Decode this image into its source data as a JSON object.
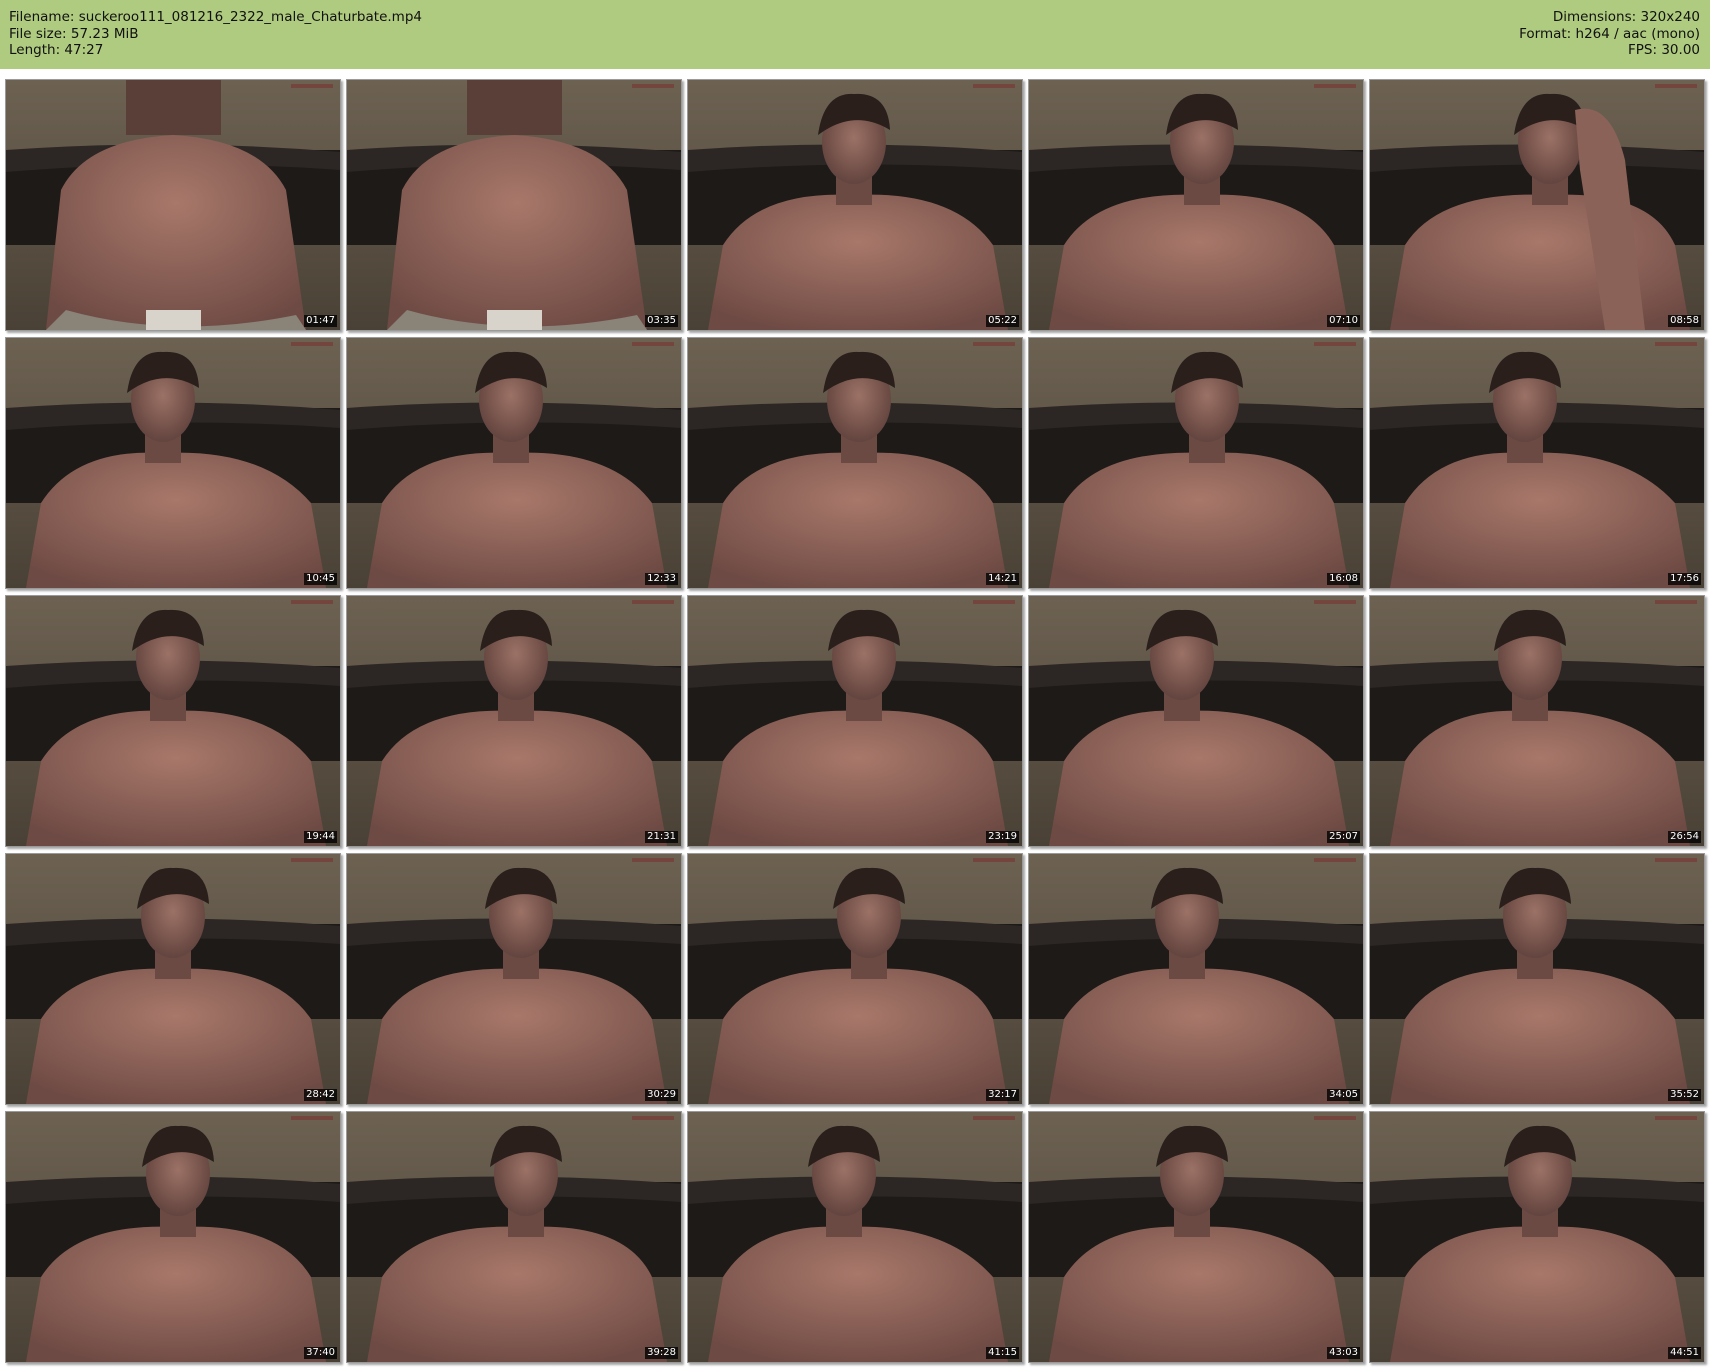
{
  "header": {
    "filename_label": "Filename: suckeroo111_081216_2322_male_Chaturbate.mp4",
    "filesize_label": "File size: 57.23 MiB",
    "length_label": "Length: 47:27",
    "dimensions_label": "Dimensions: 320x240",
    "format_label": "Format: h264 / aac (mono)",
    "fps_label": "FPS: 30.00",
    "background_color": "#afcb7f"
  },
  "thumbnails": [
    {
      "timestamp": "01:47",
      "scene": "torso-closeup"
    },
    {
      "timestamp": "03:35",
      "scene": "torso-closeup"
    },
    {
      "timestamp": "05:22",
      "scene": "face-torso"
    },
    {
      "timestamp": "07:10",
      "scene": "face-torso"
    },
    {
      "timestamp": "08:58",
      "scene": "hand-on-face"
    },
    {
      "timestamp": "10:45",
      "scene": "face-torso"
    },
    {
      "timestamp": "12:33",
      "scene": "face-torso"
    },
    {
      "timestamp": "14:21",
      "scene": "face-torso"
    },
    {
      "timestamp": "16:08",
      "scene": "face-torso"
    },
    {
      "timestamp": "17:56",
      "scene": "face-torso"
    },
    {
      "timestamp": "19:44",
      "scene": "face-torso"
    },
    {
      "timestamp": "21:31",
      "scene": "face-torso"
    },
    {
      "timestamp": "23:19",
      "scene": "face-torso"
    },
    {
      "timestamp": "25:07",
      "scene": "face-torso"
    },
    {
      "timestamp": "26:54",
      "scene": "face-torso"
    },
    {
      "timestamp": "28:42",
      "scene": "face-torso"
    },
    {
      "timestamp": "30:29",
      "scene": "face-torso"
    },
    {
      "timestamp": "32:17",
      "scene": "face-torso"
    },
    {
      "timestamp": "34:05",
      "scene": "face-torso"
    },
    {
      "timestamp": "35:52",
      "scene": "face-torso"
    },
    {
      "timestamp": "37:40",
      "scene": "face-torso"
    },
    {
      "timestamp": "39:28",
      "scene": "face-torso"
    },
    {
      "timestamp": "41:15",
      "scene": "face-torso"
    },
    {
      "timestamp": "43:03",
      "scene": "face-torso"
    },
    {
      "timestamp": "44:51",
      "scene": "face-torso"
    }
  ]
}
